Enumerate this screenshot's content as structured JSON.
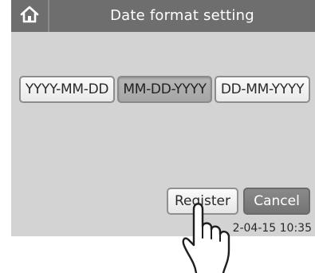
{
  "header": {
    "title": "Date format setting",
    "home_icon": "home-icon"
  },
  "date_formats": {
    "options": [
      "YYYY-MM-DD",
      "MM-DD-YYYY",
      "DD-MM-YYYY"
    ],
    "selected": "MM-DD-YYYY"
  },
  "actions": {
    "register_label": "Register",
    "cancel_label": "Cancel"
  },
  "status": {
    "datetime": "2-04-15 10:35"
  },
  "overlay": {
    "pointer_icon": "pointing-hand-icon"
  },
  "colors": {
    "titlebar": "#6e6e6e",
    "screen_background": "#d3d3d3",
    "selected_button": "#aaaaaa",
    "cancel_button": "#7c7c7c"
  }
}
